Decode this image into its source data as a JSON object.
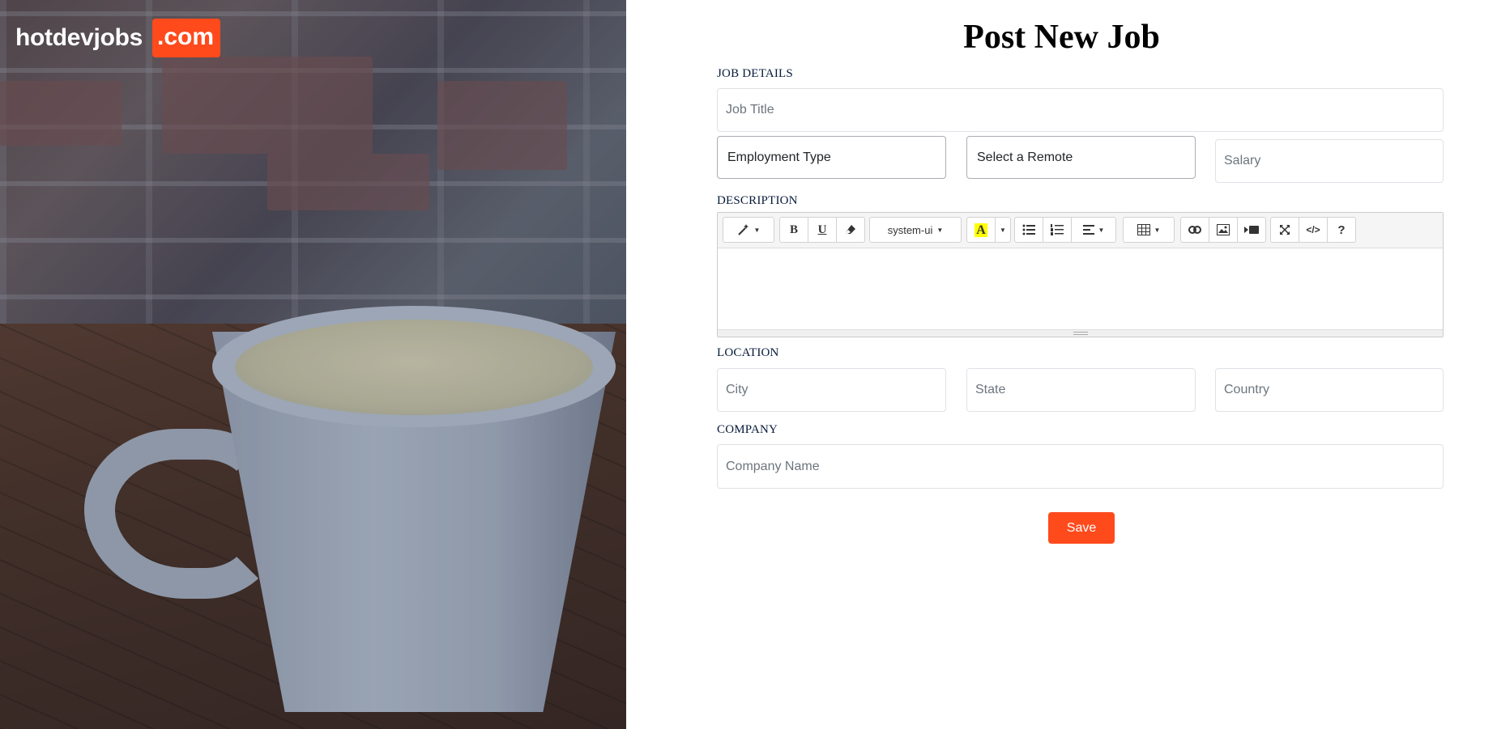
{
  "brand": {
    "name": "hotdevjobs",
    "tld": ".com",
    "accent_color": "#ff4a1c"
  },
  "photo": {
    "subject": "coffee-mug-on-wooden-table"
  },
  "page": {
    "title": "Post New Job"
  },
  "job_details": {
    "label": "JOB DETAILS",
    "job_title_placeholder": "Job Title",
    "employment_type_value": "Employment Type",
    "remote_value": "Select a Remote",
    "salary_placeholder": "Salary"
  },
  "description": {
    "label": "DESCRIPTION",
    "toolbar": {
      "style_icon": "magic-wand-icon",
      "font_name": "system-ui",
      "buttons": [
        "bold-icon",
        "underline-icon",
        "eraser-icon",
        "text-color-icon",
        "unordered-list-icon",
        "ordered-list-icon",
        "align-icon",
        "table-icon",
        "link-icon",
        "picture-icon",
        "video-icon",
        "fullscreen-icon",
        "code-view-icon",
        "help-icon"
      ],
      "highlight_color": "#ffff00"
    }
  },
  "location": {
    "label": "LOCATION",
    "city_placeholder": "City",
    "state_placeholder": "State",
    "country_placeholder": "Country"
  },
  "company": {
    "label": "COMPANY",
    "name_placeholder": "Company Name"
  },
  "actions": {
    "save_label": "Save"
  }
}
